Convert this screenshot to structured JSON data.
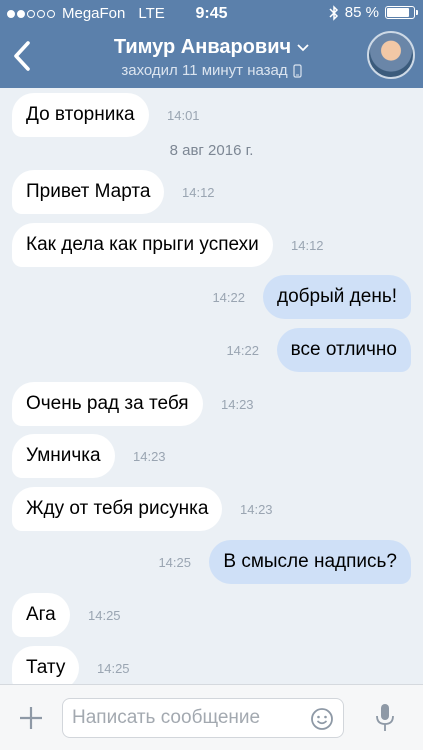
{
  "status_bar": {
    "carrier": "MegaFon",
    "network": "LTE",
    "time": "9:45",
    "battery": "85 %",
    "battery_level": 0.85
  },
  "header": {
    "back_icon": "chevron-left-icon",
    "name": "Тимур Анварович",
    "last_seen": "заходил 11 минут назад",
    "device_icon": "phone-icon",
    "dropdown_icon": "chevron-down-icon"
  },
  "messages": [
    {
      "dir": "in",
      "text": "До вторника",
      "time": "14:01"
    },
    {
      "type": "date",
      "text": "8 авг 2016 г."
    },
    {
      "dir": "in",
      "text": "Привет Марта",
      "time": "14:12"
    },
    {
      "dir": "in",
      "text": "Как дела как прыги успехи",
      "time": "14:12"
    },
    {
      "dir": "out",
      "text": "добрый день!",
      "time": "14:22"
    },
    {
      "dir": "out",
      "text": "все отлично",
      "time": "14:22"
    },
    {
      "dir": "in",
      "text": "Очень рад за тебя",
      "time": "14:23"
    },
    {
      "dir": "in",
      "text": "Умничка",
      "time": "14:23"
    },
    {
      "dir": "in",
      "text": "Жду от тебя рисунка",
      "time": "14:23"
    },
    {
      "dir": "out",
      "text": "В смысле надпись?",
      "time": "14:25"
    },
    {
      "dir": "in",
      "text": "Ага",
      "time": "14:25"
    },
    {
      "dir": "in",
      "text": "Тату",
      "time": "14:25"
    }
  ],
  "input": {
    "placeholder": "Написать сообщение"
  },
  "colors": {
    "header": "#5b80ab",
    "background": "#ebf0f5",
    "incoming_bubble": "#ffffff",
    "outgoing_bubble": "#cfe0f7"
  }
}
